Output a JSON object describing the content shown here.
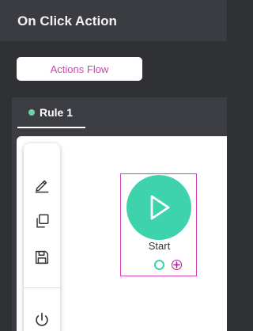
{
  "window": {
    "title": "On Click Action"
  },
  "actions_flow_button": {
    "label": "Actions Flow"
  },
  "tabs": [
    {
      "label": "Rule 1",
      "status_color": "#6fd0a6"
    }
  ],
  "toolbar": {
    "tools": [
      {
        "icon": "pencil-icon"
      },
      {
        "icon": "copy-icon"
      },
      {
        "icon": "save-icon"
      },
      {
        "icon": "power-icon"
      }
    ]
  },
  "node": {
    "label": "Start",
    "icon": "play-icon",
    "colors": {
      "circle": "#3fd3ad",
      "selection": "#d63fb5"
    }
  },
  "colors": {
    "accent": "#d63fb5",
    "node": "#3fd3ad",
    "titlebar": "#3a3c41"
  }
}
